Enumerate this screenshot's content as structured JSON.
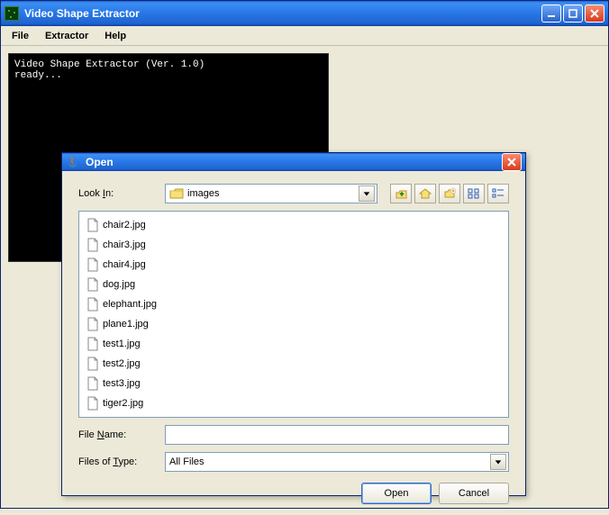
{
  "window": {
    "title": "Video Shape Extractor"
  },
  "menubar": {
    "file": "File",
    "extractor": "Extractor",
    "help": "Help"
  },
  "console": {
    "line1": "Video Shape Extractor (Ver. 1.0)",
    "line2": "ready..."
  },
  "dialog": {
    "title": "Open",
    "lookin_label": "Look In:",
    "lookin_value": "images",
    "filename_label": "File Name:",
    "filename_value": "",
    "filetype_label": "Files of Type:",
    "filetype_value": "All Files",
    "open_btn": "Open",
    "cancel_btn": "Cancel",
    "files": {
      "f0": "chair2.jpg",
      "f1": "chair3.jpg",
      "f2": "chair4.jpg",
      "f3": "dog.jpg",
      "f4": "elephant.jpg",
      "f5": "plane1.jpg",
      "f6": "test1.jpg",
      "f7": "test2.jpg",
      "f8": "test3.jpg",
      "f9": "tiger2.jpg"
    }
  }
}
